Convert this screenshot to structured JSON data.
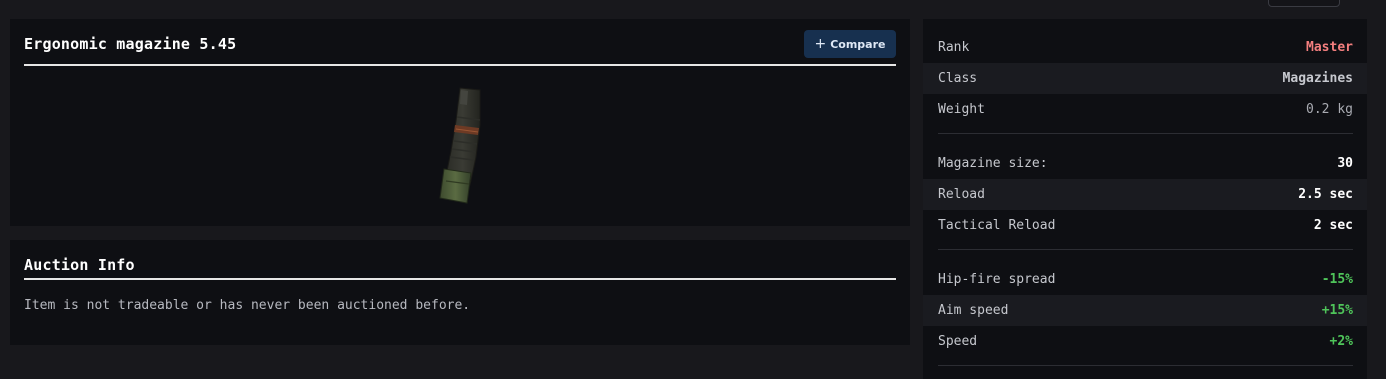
{
  "item": {
    "title": "Ergonomic magazine 5.45",
    "compare_label": "Compare",
    "image_icon": "magazine-icon"
  },
  "auction": {
    "title": "Auction Info",
    "message": "Item is not tradeable or has never been auctioned before."
  },
  "stats": {
    "general": [
      {
        "label": "Rank",
        "value": "Master"
      },
      {
        "label": "Class",
        "value": "Magazines"
      },
      {
        "label": "Weight",
        "value": "0.2 kg"
      }
    ],
    "magazine": [
      {
        "label": "Magazine size:",
        "value": "30"
      },
      {
        "label": "Reload",
        "value": "2.5 sec"
      },
      {
        "label": "Tactical Reload",
        "value": "2 sec"
      }
    ],
    "modifiers": [
      {
        "label": "Hip-fire spread",
        "value": "-15%"
      },
      {
        "label": "Aim speed",
        "value": "+15%"
      },
      {
        "label": "Speed",
        "value": "+2%"
      }
    ]
  },
  "colors": {
    "rank_master": "#f47f7f",
    "positive": "#4fc55a",
    "button_bg": "#17304f",
    "panel_bg": "#0e0f13",
    "page_bg": "#18181c"
  }
}
